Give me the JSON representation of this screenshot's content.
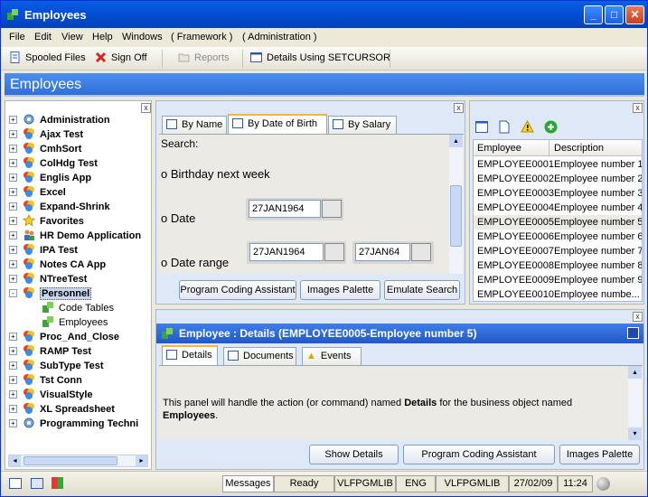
{
  "window": {
    "title": "Employees"
  },
  "menu": [
    "File",
    "Edit",
    "View",
    "Help",
    "Windows",
    "( Framework )",
    "( Administration )"
  ],
  "toolbar": {
    "spooled": "Spooled Files",
    "signoff": "Sign Off",
    "reports": "Reports",
    "details": "Details Using SETCURSOR"
  },
  "banner": "Employees",
  "tree": [
    {
      "label": "Administration",
      "expander": "+",
      "icon": "gear-icon"
    },
    {
      "label": "Ajax Test",
      "expander": "+",
      "icon": "app-icon"
    },
    {
      "label": "CmhSort",
      "expander": "+",
      "icon": "app-icon"
    },
    {
      "label": "ColHdg Test",
      "expander": "+",
      "icon": "app-icon"
    },
    {
      "label": "Englis App",
      "expander": "+",
      "icon": "app-icon"
    },
    {
      "label": "Excel",
      "expander": "+",
      "icon": "app-icon"
    },
    {
      "label": "Expand-Shrink",
      "expander": "+",
      "icon": "app-icon"
    },
    {
      "label": "Favorites",
      "expander": "+",
      "icon": "star-icon"
    },
    {
      "label": "HR Demo Application",
      "expander": "+",
      "icon": "people-icon"
    },
    {
      "label": "IPA Test",
      "expander": "+",
      "icon": "app-icon"
    },
    {
      "label": "Notes CA App",
      "expander": "+",
      "icon": "app-icon"
    },
    {
      "label": "NTreeTest",
      "expander": "+",
      "icon": "app-icon"
    },
    {
      "label": "Personnel",
      "expander": "-",
      "icon": "app-icon",
      "selected": true
    },
    {
      "label": "Code Tables",
      "child": true,
      "icon": "puzzle-icon"
    },
    {
      "label": "Employees",
      "child": true,
      "icon": "puzzle-icon"
    },
    {
      "label": "Proc_And_Close",
      "expander": "+",
      "icon": "app-icon"
    },
    {
      "label": "RAMP Test",
      "expander": "+",
      "icon": "app-icon"
    },
    {
      "label": "SubType Test",
      "expander": "+",
      "icon": "app-icon"
    },
    {
      "label": "Tst Conn",
      "expander": "+",
      "icon": "app-icon"
    },
    {
      "label": "VisualStyle",
      "expander": "+",
      "icon": "app-icon"
    },
    {
      "label": "XL Spreadsheet",
      "expander": "+",
      "icon": "app-icon"
    },
    {
      "label": "Programming Techni",
      "expander": "+",
      "icon": "gear-icon"
    }
  ],
  "search": {
    "tabs": [
      "By Name",
      "By Date of Birth",
      "By Salary"
    ],
    "heading": "Search:",
    "opt_birthday": "o Birthday next week",
    "opt_date": "o Date",
    "opt_range": "o Date range",
    "date_value": "27JAN1964",
    "range_from": "27JAN1964",
    "range_to": "27JAN64",
    "btn_coding": "Program Coding Assistant",
    "btn_images": "Images Palette",
    "btn_emulate": "Emulate Search"
  },
  "list": {
    "col_employee": "Employee",
    "col_description": "Description",
    "rows": [
      [
        "EMPLOYEE0001",
        "Employee number 1"
      ],
      [
        "EMPLOYEE0002",
        "Employee number 2"
      ],
      [
        "EMPLOYEE0003",
        "Employee number 3"
      ],
      [
        "EMPLOYEE0004",
        "Employee number 4"
      ],
      [
        "EMPLOYEE0005",
        "Employee number 5"
      ],
      [
        "EMPLOYEE0006",
        "Employee number 6"
      ],
      [
        "EMPLOYEE0007",
        "Employee number 7"
      ],
      [
        "EMPLOYEE0008",
        "Employee number 8"
      ],
      [
        "EMPLOYEE0009",
        "Employee number 9"
      ],
      [
        "EMPLOYEE0010",
        "Employee numbe..."
      ]
    ],
    "selected_index": 4
  },
  "details": {
    "title": "Employee : Details (EMPLOYEE0005-Employee number 5)",
    "tabs": [
      "Details",
      "Documents",
      "Events"
    ],
    "text1": "This panel will handle the action (or command) named ",
    "text_bold1": "Details",
    "text2": " for the business object named ",
    "text_bold2": "Employees",
    "text3": ".",
    "btn_show": "Show Details",
    "btn_coding": "Program Coding Assistant",
    "btn_images": "Images Palette"
  },
  "status": {
    "messages": "Messages",
    "ready": "Ready",
    "lib1": "VLFPGMLIB",
    "lang": "ENG",
    "lib2": "VLFPGMLIB",
    "date": "27/02/09",
    "time": "11:24"
  }
}
